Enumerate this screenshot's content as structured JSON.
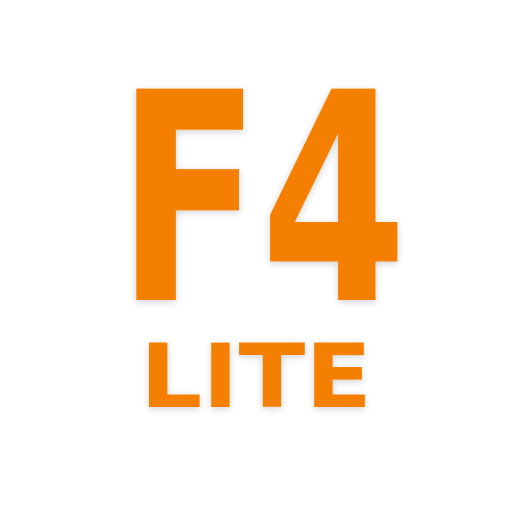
{
  "logo": {
    "main_text": "F4",
    "sub_text": "LITE",
    "color": "#F57F00",
    "background": "#FFFFFF"
  }
}
